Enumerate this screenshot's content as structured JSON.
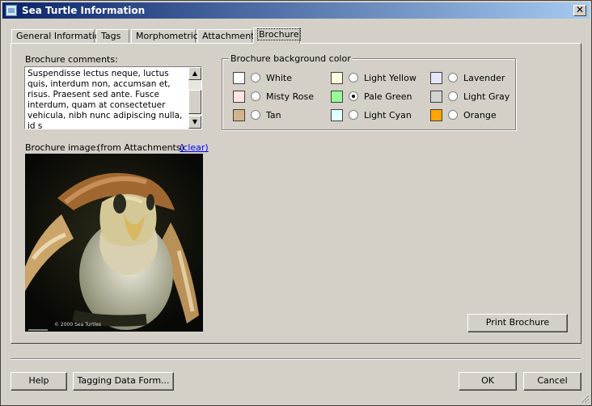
{
  "window": {
    "title": "Sea Turtle Information",
    "close_glyph": "✕"
  },
  "tabs": [
    {
      "label": "General Information"
    },
    {
      "label": "Tags"
    },
    {
      "label": "Morphometrics"
    },
    {
      "label": "Attachments"
    },
    {
      "label": "Brochure",
      "active": true
    }
  ],
  "brochure": {
    "comments_label": "Brochure comments:",
    "comments_text": "Suspendisse lectus neque, luctus quis, interdum non, accumsan et, risus. Praesent sed ante. Fusce interdum, quam at consectetuer vehicula, nibh nunc adipiscing nulla, id s",
    "image_label": "Brochure image:",
    "image_source_note": "(from Attachments)",
    "clear_link": "(clear)",
    "image_caption": "© 2000 Sea Turtles",
    "print_button": "Print Brochure"
  },
  "background_color": {
    "group_title": "Brochure background color",
    "selected": "Pale Green",
    "options": [
      {
        "label": "White",
        "color": "#ffffff"
      },
      {
        "label": "Misty Rose",
        "color": "#ffe4e1"
      },
      {
        "label": "Tan",
        "color": "#d2b48c"
      },
      {
        "label": "Light Yellow",
        "color": "#ffffe0"
      },
      {
        "label": "Pale Green",
        "color": "#98fb98"
      },
      {
        "label": "Light Cyan",
        "color": "#e0ffff"
      },
      {
        "label": "Lavender",
        "color": "#e6e6fa"
      },
      {
        "label": "Light Gray",
        "color": "#d3d3d3"
      },
      {
        "label": "Orange",
        "color": "#ffa500"
      }
    ]
  },
  "footer": {
    "help_button": "Help",
    "tagging_button": "Tagging Data Form...",
    "ok_button": "OK",
    "cancel_button": "Cancel"
  },
  "icons": {
    "app": "app-window-icon",
    "scroll_up": "▲",
    "scroll_down": "▼",
    "resize": "resize-grip-icon"
  }
}
